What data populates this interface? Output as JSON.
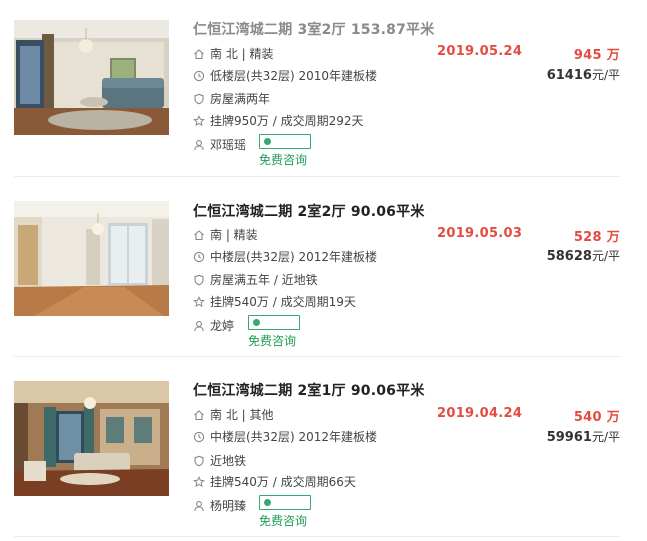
{
  "listings": [
    {
      "title": "仁恒江湾城二期 3室2厅 153.87平米",
      "orientation_deco": "南 北 | 精装",
      "floor_year": "低楼层(共32层) 2010年建板楼",
      "tags": "房屋满两年",
      "listing_cycle": "挂牌950万 / 成交周期292天",
      "agent": "邓瑶瑶",
      "consult_label": "免费咨询",
      "date": "2019.05.24",
      "price_num": "945",
      "price_unit": "万",
      "unit_price_num": "61416",
      "unit_price_suffix": "元/平"
    },
    {
      "title": "仁恒江湾城二期 2室2厅 90.06平米",
      "orientation_deco": "南 | 精装",
      "floor_year": "中楼层(共32层) 2012年建板楼",
      "tags": "房屋满五年 / 近地铁",
      "listing_cycle": "挂牌540万 / 成交周期19天",
      "agent": "龙婷",
      "consult_label": "免费咨询",
      "date": "2019.05.03",
      "price_num": "528",
      "price_unit": "万",
      "unit_price_num": "58628",
      "unit_price_suffix": "元/平"
    },
    {
      "title": "仁恒江湾城二期 2室1厅 90.06平米",
      "orientation_deco": "南 北 | 其他",
      "floor_year": "中楼层(共32层) 2012年建板楼",
      "tags": "近地铁",
      "listing_cycle": "挂牌540万 / 成交周期66天",
      "agent": "杨明臻",
      "consult_label": "免费咨询",
      "date": "2019.04.24",
      "price_num": "540",
      "price_unit": "万",
      "unit_price_num": "59961",
      "unit_price_suffix": "元/平"
    }
  ],
  "icons": [
    "house-icon",
    "clock-icon",
    "shield-icon",
    "star-icon",
    "person-icon",
    "chat-icon"
  ],
  "colors": {
    "price_red": "#e44c40",
    "consult_green": "#1f9d55",
    "chat_border": "#38a86f",
    "title_dark": "#222222",
    "title_visited": "#8a8a8a"
  }
}
